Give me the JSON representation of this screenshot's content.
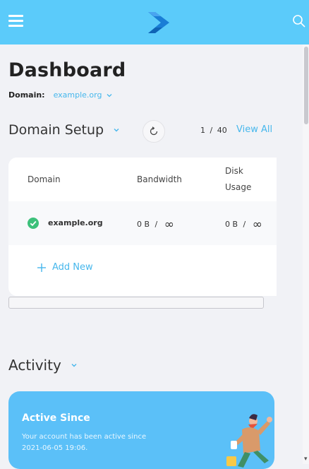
{
  "header": {
    "menu_icon": "hamburger-menu-icon",
    "logo_icon": "brand-logo-icon",
    "search_icon": "search-icon",
    "bar_color": "#5bcbfa"
  },
  "page": {
    "title": "Dashboard",
    "domain_label": "Domain:",
    "domain_value": "example.org"
  },
  "domain_setup": {
    "title": "Domain Setup",
    "pager_current": "1",
    "pager_sep": "/",
    "pager_total": "40",
    "view_all": "View All",
    "columns": [
      "Domain",
      "Bandwidth",
      "Disk",
      "Usage"
    ],
    "rows": [
      {
        "status": "active",
        "domain": "example.org",
        "bandwidth_used": "0 B",
        "bandwidth_sep": "/",
        "bandwidth_limit": "∞",
        "disk_used": "0 B",
        "disk_sep": "/",
        "disk_limit": "∞"
      }
    ],
    "add_new": "Add New"
  },
  "activity": {
    "title": "Activity",
    "card_title": "Active Since",
    "card_text": "Your account has been active since 2021-06-05 19:06."
  },
  "colors": {
    "accent": "#46b7ec",
    "success": "#3cc07a",
    "card_blue": "#5bc0f8"
  }
}
